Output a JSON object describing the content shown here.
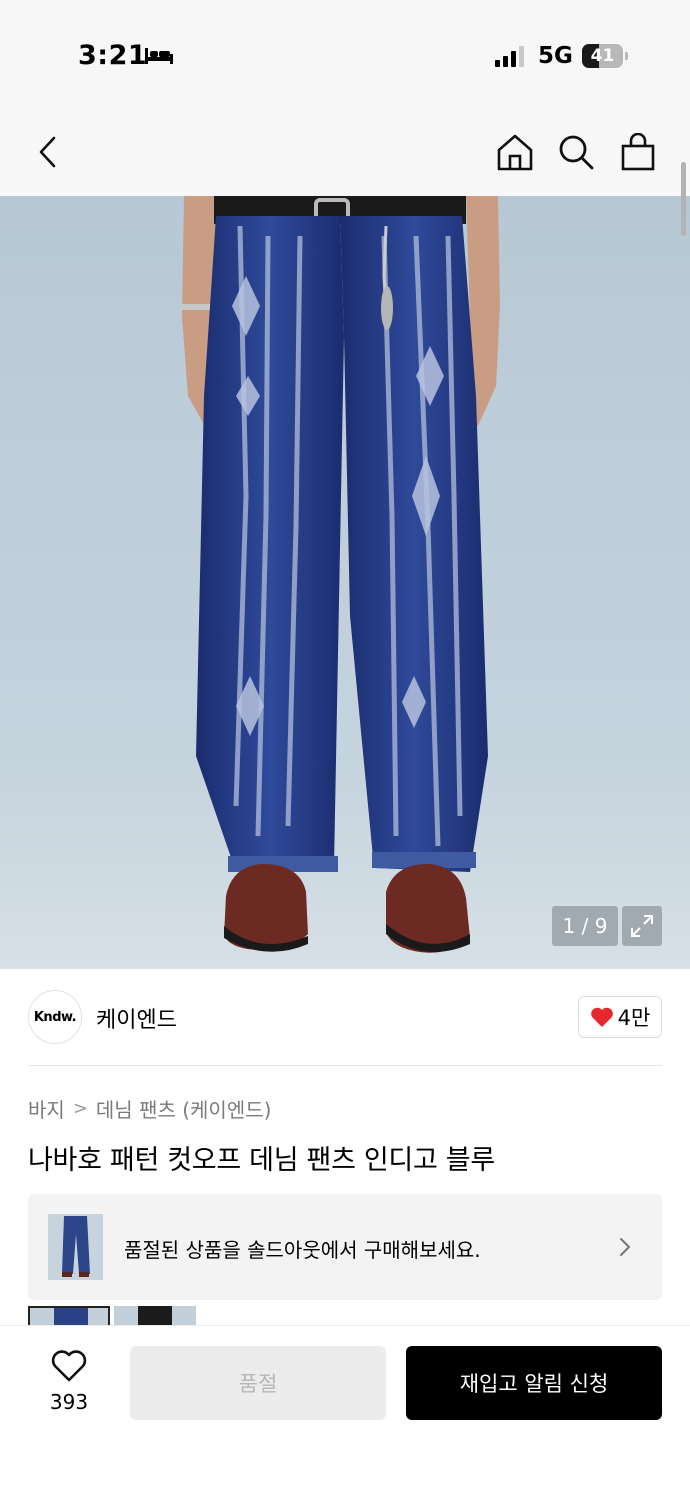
{
  "status_bar": {
    "time": "3:21",
    "network": "5G",
    "battery_level": "41",
    "icons": [
      "bed-icon",
      "signal-icon",
      "battery-icon"
    ]
  },
  "nav": {
    "icons": [
      "back-chevron-icon",
      "home-icon",
      "search-icon",
      "shopping-bag-icon"
    ]
  },
  "gallery": {
    "counter": "1 / 9",
    "current": 1,
    "total": 9,
    "expand_icon": "expand-icon"
  },
  "brand": {
    "logo_text": "Kndw.",
    "name": "케이엔드",
    "likes": "4만",
    "like_icon": "heart-filled-icon",
    "like_color": "#e8262e"
  },
  "breadcrumb": {
    "items": [
      "바지",
      "데님 팬츠 (케이엔드)"
    ]
  },
  "product": {
    "title": "나바호 패턴 컷오프 데님 팬츠 인디고 블루"
  },
  "soldout_banner": {
    "text": "품절된 상품을 솔드아웃에서 구매해보세요."
  },
  "bottom_bar": {
    "wish_count": "393",
    "soldout_label": "품절",
    "restock_label": "재입고 알림 신청"
  }
}
